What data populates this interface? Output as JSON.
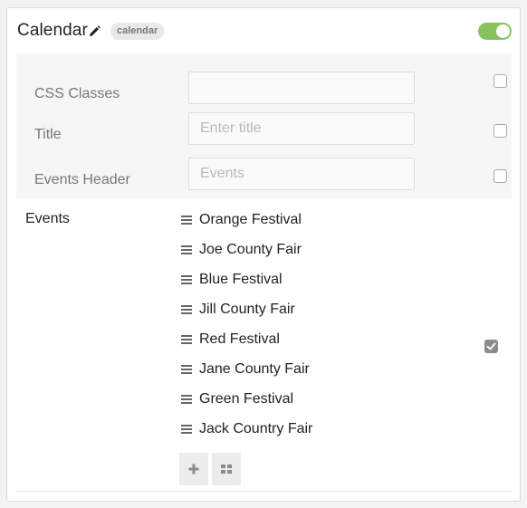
{
  "header": {
    "title": "Calendar",
    "badge": "calendar",
    "edit_icon": "pencil-icon",
    "toggle_on": true,
    "toggle_color": "#88c25d"
  },
  "settings": {
    "css_classes": {
      "label": "CSS Classes",
      "value": "",
      "placeholder": "",
      "checked": false
    },
    "title": {
      "label": "Title",
      "value": "",
      "placeholder": "Enter title",
      "checked": false
    },
    "events_header": {
      "label": "Events Header",
      "value": "",
      "placeholder": "Events",
      "checked": false
    }
  },
  "events": {
    "label": "Events",
    "checked": true,
    "drag_icon": "drag-handle-icon",
    "items": [
      "Orange Festival",
      "Joe County Fair",
      "Blue Festival",
      "Jill County Fair",
      "Red Festival",
      "Jane County Fair",
      "Green Festival",
      "Jack Country Fair"
    ],
    "add_icon": "plus-icon",
    "grid_icon": "grid-icon"
  }
}
